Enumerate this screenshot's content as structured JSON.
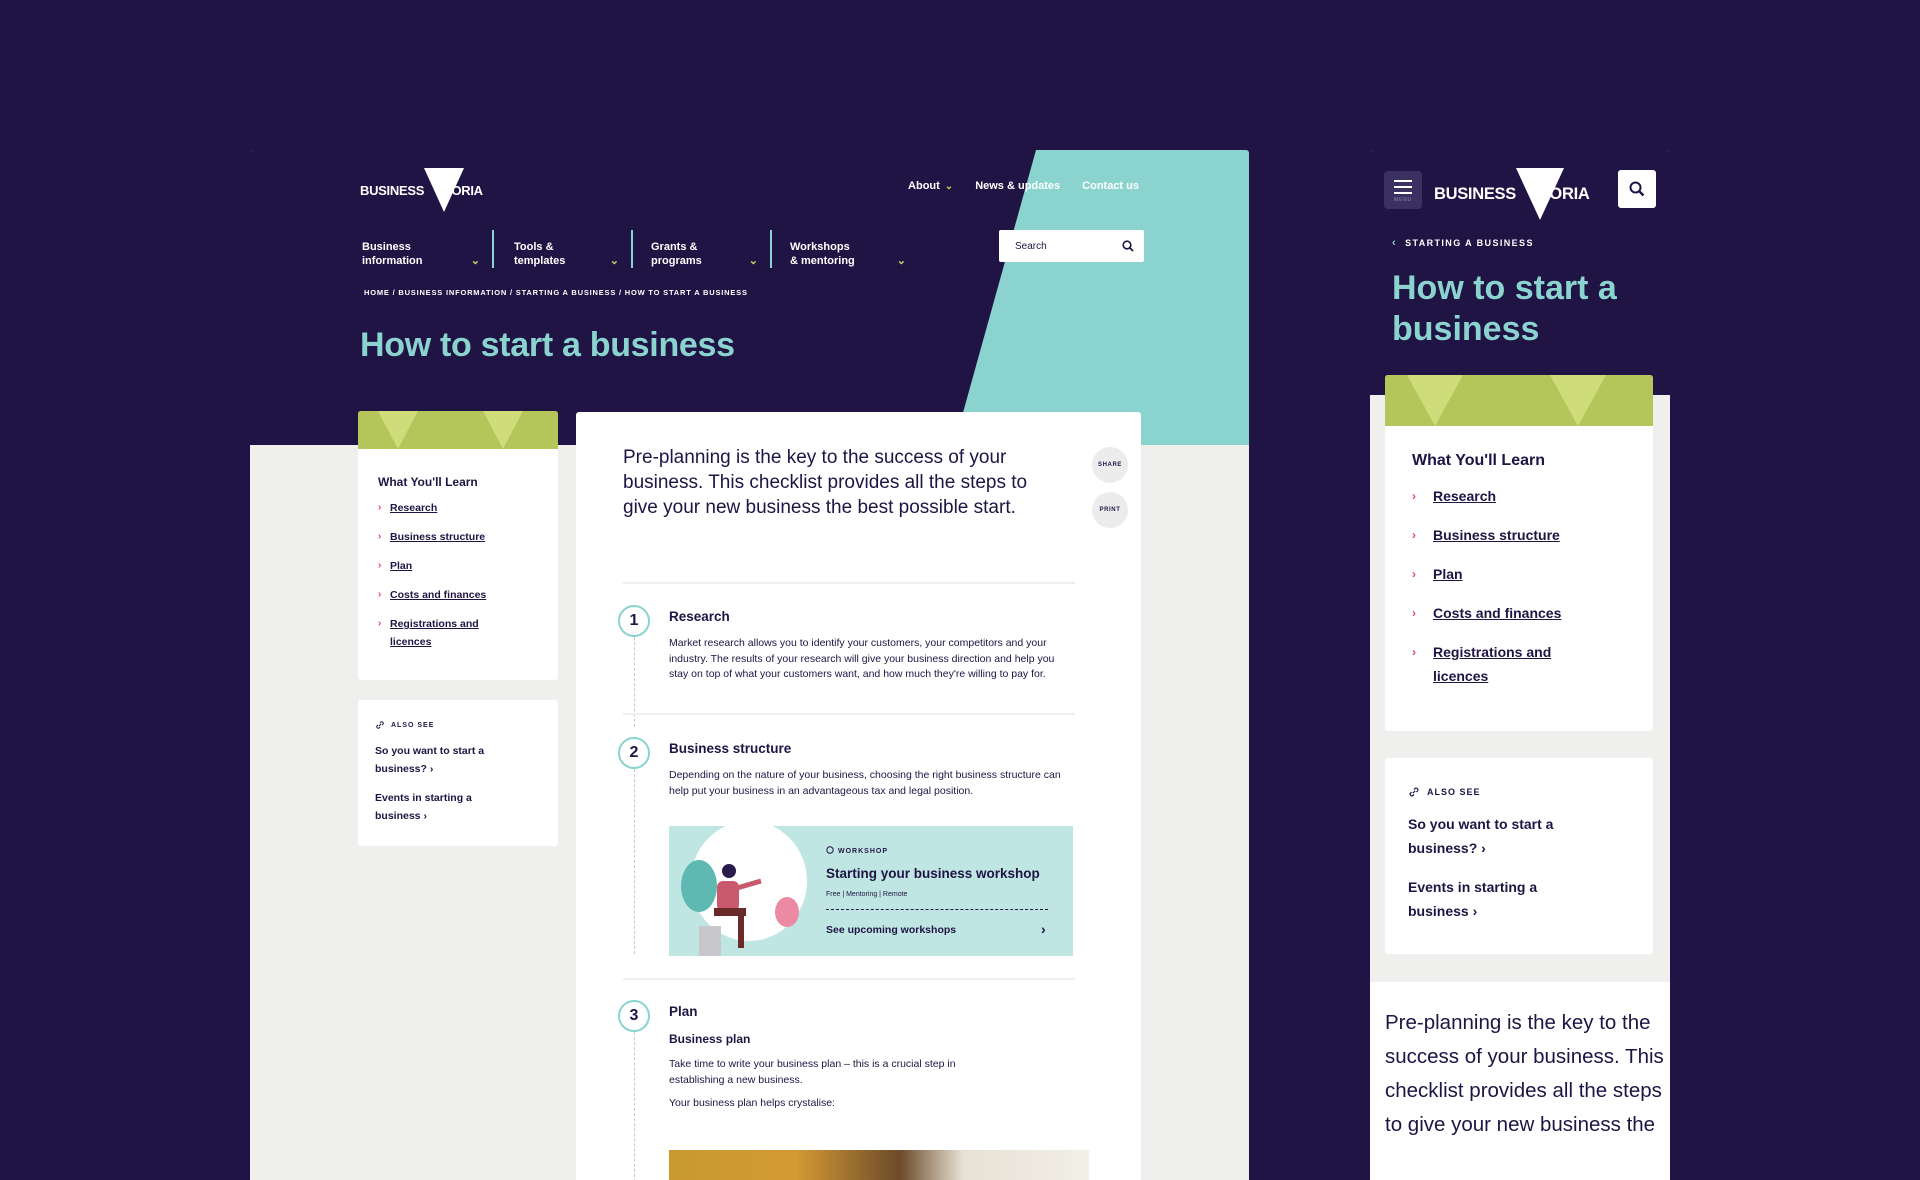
{
  "colors": {
    "navy": "#1f1444",
    "teal": "#8ad3cf",
    "lime": "#b4c55a",
    "accent_pink": "#e0427a",
    "page_bg": "#efefed"
  },
  "logo": {
    "left": "BUSINESS",
    "middle": "VIC",
    "right": "TORIA"
  },
  "desktop": {
    "utility_nav": [
      {
        "label": "About",
        "icon": "chevron-down-icon"
      },
      {
        "label": "News & updates"
      },
      {
        "label": "Contact us"
      }
    ],
    "main_nav": [
      {
        "line1": "Business",
        "line2": "information"
      },
      {
        "line1": "Tools &",
        "line2": "templates"
      },
      {
        "line1": "Grants &",
        "line2": "programs"
      },
      {
        "line1": "Workshops",
        "line2": "& mentoring"
      }
    ],
    "search": {
      "placeholder": "Search",
      "icon": "search-icon"
    },
    "breadcrumb": "HOME / BUSINESS INFORMATION / STARTING A BUSINESS / HOW TO START A BUSINESS",
    "title": "How to start a business",
    "learn": {
      "heading": "What You'll Learn",
      "items": [
        "Research",
        "Business structure",
        "Plan",
        "Costs and finances",
        "Registrations and licences"
      ]
    },
    "also_see": {
      "heading": "ALSO SEE",
      "links": [
        "So you want to start a business?",
        "Events in starting a business"
      ]
    },
    "intro": "Pre-planning is the key to the success of your business. This checklist provides all the steps to give your new business the best possible start.",
    "share_label": "SHARE",
    "print_label": "PRINT",
    "steps": [
      {
        "num": "1",
        "title": "Research",
        "text": "Market research allows you to identify your customers, your competitors and your industry. The results of your research will give your business direction and help you stay on top of what your customers want, and how much they're willing to pay for."
      },
      {
        "num": "2",
        "title": "Business structure",
        "text": "Depending on the nature of your business, choosing the right business structure can help put your business in an advantageous tax and legal position."
      },
      {
        "num": "3",
        "title": "Plan",
        "subtitle": "Business plan",
        "text": "Take time to write your business plan – this is a crucial step in establishing a new business.",
        "text2": "Your business plan helps crystalise:"
      }
    ],
    "workshop": {
      "kicker": "WORKSHOP",
      "title": "Starting your business workshop",
      "meta": "Free  |  Mentoring  |  Remote",
      "link": "See upcoming workshops"
    }
  },
  "mobile": {
    "menu_label": "MENU",
    "back_link": "STARTING A BUSINESS",
    "title": "How to start a business",
    "intro": "Pre-planning is the key to the success of your business. This checklist provides all the steps to give your new business the"
  }
}
